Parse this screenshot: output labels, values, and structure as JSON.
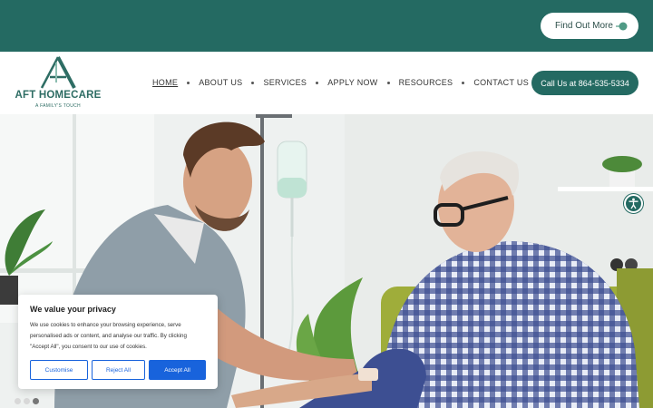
{
  "topbar": {
    "cta_label": "Find Out More",
    "cta_icon": "arrow-right-icon",
    "color": "#246a62"
  },
  "header": {
    "logo": {
      "brand": "AFT HOMECARE",
      "tagline": "A FAMILY'S TOUCH"
    },
    "nav": [
      {
        "label": "HOME",
        "active": true
      },
      {
        "label": "ABOUT US"
      },
      {
        "label": "SERVICES"
      },
      {
        "label": "APPLY NOW"
      },
      {
        "label": "RESOURCES"
      },
      {
        "label": "CONTACT US"
      }
    ],
    "call_button": "Call Us at 864-535-5334"
  },
  "hero": {
    "image": "nurse-treating-elderly-patient-photo",
    "accessibility_icon": "accessibility-icon",
    "slides_total": 3,
    "slide_current": 3
  },
  "cookie_banner": {
    "title": "We value your privacy",
    "text": "We use cookies to enhance your browsing experience, serve personalised ads or content, and analyse our traffic. By clicking \"Accept All\", you consent to our use of cookies.",
    "buttons": {
      "customise": "Customise",
      "reject": "Reject All",
      "accept": "Accept All"
    },
    "accent": "#1863dc"
  }
}
